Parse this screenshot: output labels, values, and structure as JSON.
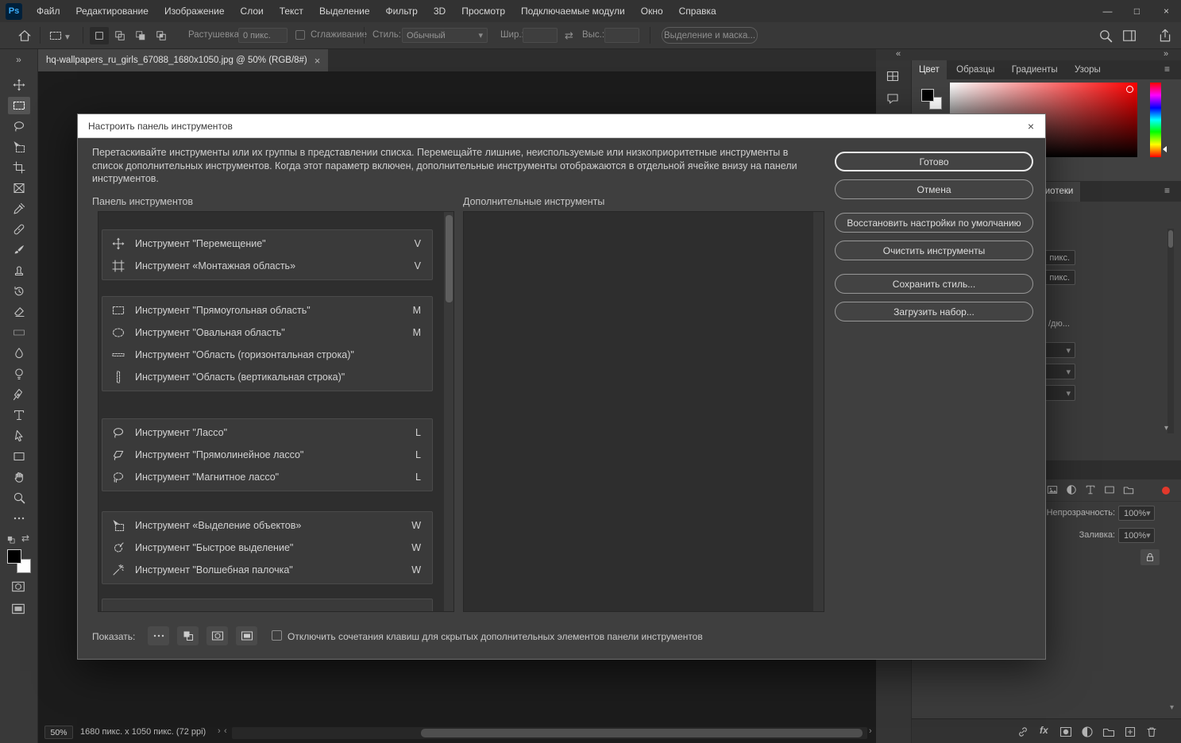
{
  "app": {
    "logo": "Ps"
  },
  "glyphs": {
    "menu_min": "—",
    "menu_max": "□",
    "menu_close": "×",
    "tab_close": "×",
    "dialog_close": "×",
    "collapse_left": "«",
    "collapse_right": "»",
    "hamburger": "≡",
    "dropdown": "▾",
    "swap": "⇄",
    "scroll_left": "‹",
    "scroll_right": "›",
    "scroll_down": "▾",
    "doc_info_chevron": "›",
    "fx": "fx"
  },
  "menu_bar": {
    "items": [
      {
        "label": "Файл"
      },
      {
        "label": "Редактирование"
      },
      {
        "label": "Изображение"
      },
      {
        "label": "Слои"
      },
      {
        "label": "Текст"
      },
      {
        "label": "Выделение"
      },
      {
        "label": "Фильтр"
      },
      {
        "label": "3D"
      },
      {
        "label": "Просмотр"
      },
      {
        "label": "Подключаемые модули"
      },
      {
        "label": "Окно"
      },
      {
        "label": "Справка"
      }
    ]
  },
  "options_bar": {
    "feather_label": "Растушевка:",
    "feather_value": "0 пикс.",
    "antialias_label": "Сглаживание",
    "style_label": "Стиль:",
    "style_value": "Обычный",
    "width_label": "Шир.:",
    "height_label": "Выс.:",
    "select_and_mask_button": "Выделение и маска..."
  },
  "document_tab": {
    "title": "hq-wallpapers_ru_girls_67088_1680x1050.jpg @ 50% (RGB/8#)"
  },
  "toolbar_icons": [
    "move-icon",
    "rectangular-marquee-icon",
    "lasso-icon",
    "object-selection-icon",
    "crop-icon",
    "frame-icon",
    "eyedropper-icon",
    "healing-brush-icon",
    "brush-icon",
    "clone-stamp-icon",
    "history-brush-icon",
    "eraser-icon",
    "gradient-icon",
    "blur-icon",
    "dodge-icon",
    "pen-icon",
    "type-icon",
    "path-selection-icon",
    "rectangle-icon",
    "hand-icon",
    "zoom-icon",
    "edit-toolbar-icon"
  ],
  "dialog": {
    "title": "Настроить панель инструментов",
    "description": "Перетаскивайте инструменты или их группы в представлении списка. Перемещайте лишние, неиспользуемые или низкоприоритетные инструменты в список дополнительных инструментов. Когда этот параметр включен, дополнительные инструменты отображаются в отдельной ячейке внизу на панели инструментов.",
    "toolbar_column_header": "Панель инструментов",
    "extra_column_header": "Дополнительные инструменты",
    "groups": [
      {
        "tools": [
          {
            "icon": "move-icon",
            "label": "Инструмент \"Перемещение\"",
            "key": "V"
          },
          {
            "icon": "artboard-icon",
            "label": "Инструмент «Монтажная область»",
            "key": "V"
          }
        ]
      },
      {
        "tools": [
          {
            "icon": "rectangular-marquee-icon",
            "label": "Инструмент \"Прямоугольная область\"",
            "key": "M"
          },
          {
            "icon": "elliptical-marquee-icon",
            "label": "Инструмент \"Овальная область\"",
            "key": "M"
          },
          {
            "icon": "single-row-marquee-icon",
            "label": "Инструмент \"Область (горизонтальная строка)\"",
            "key": ""
          },
          {
            "icon": "single-column-marquee-icon",
            "label": "Инструмент \"Область (вертикальная строка)\"",
            "key": ""
          }
        ]
      },
      {
        "tools": [
          {
            "icon": "lasso-icon",
            "label": "Инструмент \"Лассо\"",
            "key": "L"
          },
          {
            "icon": "polygonal-lasso-icon",
            "label": "Инструмент \"Прямолинейное лассо\"",
            "key": "L"
          },
          {
            "icon": "magnetic-lasso-icon",
            "label": "Инструмент \"Магнитное лассо\"",
            "key": "L"
          }
        ]
      },
      {
        "tools": [
          {
            "icon": "object-selection-icon",
            "label": "Инструмент «Выделение объектов»",
            "key": "W"
          },
          {
            "icon": "quick-selection-icon",
            "label": "Инструмент \"Быстрое выделение\"",
            "key": "W"
          },
          {
            "icon": "magic-wand-icon",
            "label": "Инструмент \"Волшебная палочка\"",
            "key": "W"
          }
        ]
      }
    ],
    "buttons": [
      {
        "label": "Готово"
      },
      {
        "label": "Отмена"
      },
      {
        "label": "Восстановить настройки по умолчанию"
      },
      {
        "label": "Очистить инструменты"
      },
      {
        "label": "Сохранить стиль..."
      },
      {
        "label": "Загрузить набор..."
      }
    ],
    "show_label": "Показать:",
    "disable_shortcuts_label": "Отключить сочетания клавиш для скрытых дополнительных элементов панели инструментов"
  },
  "right_panels": {
    "color_tabs": [
      {
        "label": "Цвет"
      },
      {
        "label": "Образцы"
      },
      {
        "label": "Градиенты"
      },
      {
        "label": "Узоры"
      }
    ],
    "libraries_tab": "Библиотеки",
    "fragments": {
      "unit1": "пикс.",
      "unit2": "пикс.",
      "per_inch": "/дю..."
    },
    "layers": {
      "opacity_label": "Непрозрачность:",
      "opacity_value": "100%",
      "fill_label": "Заливка:",
      "fill_value": "100%"
    }
  },
  "status_bar": {
    "zoom": "50%",
    "doc_info": "1680 пикс. x 1050 пикс. (72 ppi)"
  }
}
